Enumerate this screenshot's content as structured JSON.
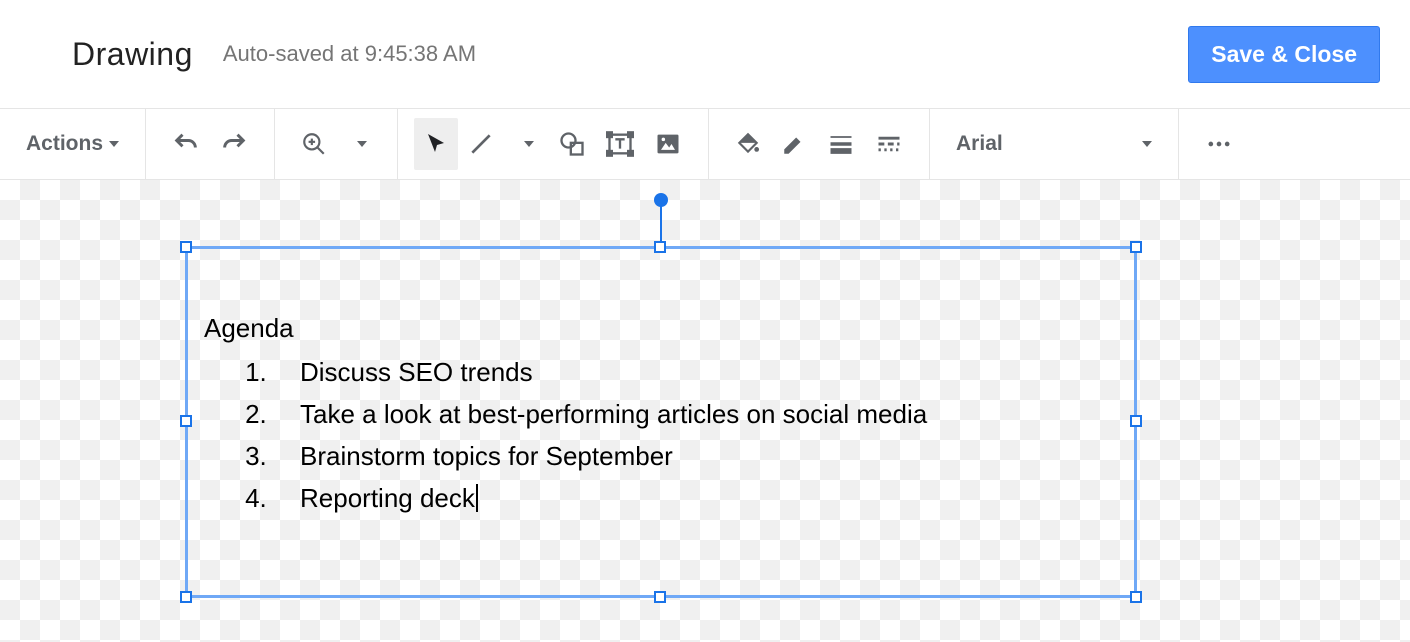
{
  "header": {
    "title": "Drawing",
    "autosave": "Auto-saved at 9:45:38 AM",
    "save_close": "Save & Close"
  },
  "toolbar": {
    "actions_label": "Actions",
    "font_name": "Arial",
    "icons": {
      "undo": "undo-icon",
      "redo": "redo-icon",
      "zoom": "zoom-icon",
      "select": "select-icon",
      "line": "line-icon",
      "shape": "shape-icon",
      "textbox": "textbox-icon",
      "image": "image-icon",
      "fill": "fill-color-icon",
      "border_color": "border-color-icon",
      "border_weight": "border-weight-icon",
      "border_dash": "border-dash-icon",
      "more": "more-icon"
    }
  },
  "textbox": {
    "title": "Agenda",
    "items": [
      "Discuss SEO trends",
      "Take a look at best-performing articles on social media",
      "Brainstorm topics for September",
      "Reporting deck"
    ]
  }
}
